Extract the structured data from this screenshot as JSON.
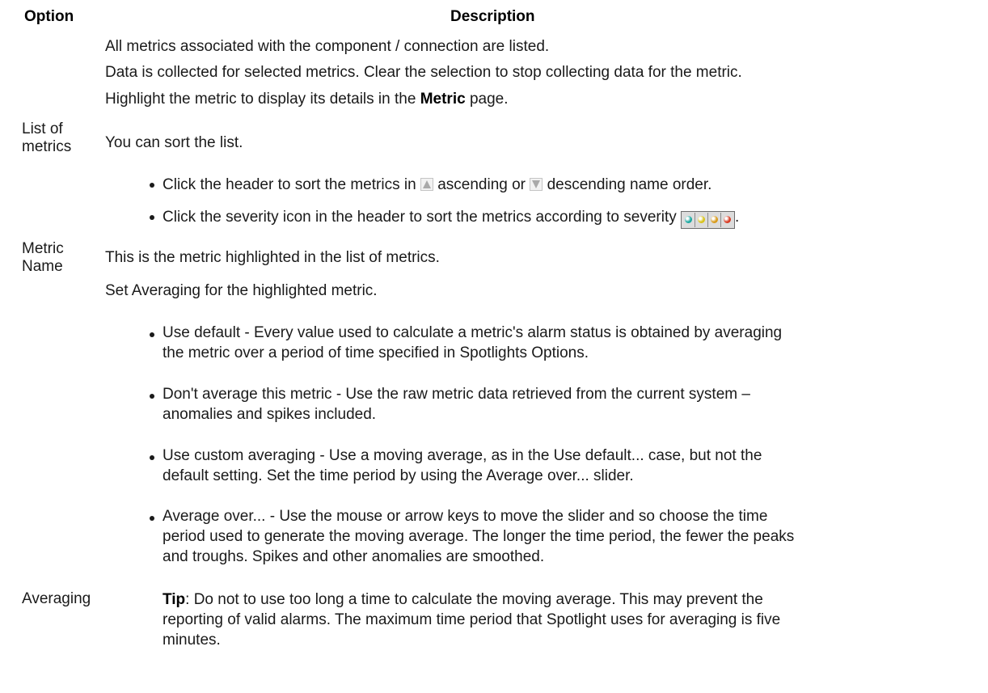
{
  "header": {
    "option": "Option",
    "description": "Description"
  },
  "rows": {
    "list_of_metrics": {
      "label_line1": "List of",
      "label_line2": "metrics",
      "p1": "All metrics associated with the component / connection are listed.",
      "p2": "Data is collected for selected metrics. Clear the selection to stop collecting data for the metric.",
      "p3_before": "Highlight the metric to display its details in the",
      "p3_bold": "Metric",
      "p3_after": "page.",
      "p4": "You can sort the list.",
      "bullet1_before": "Click the header to sort the metrics in",
      "bullet1_mid": "ascending or",
      "bullet1_after": "descending name order.",
      "bullet2": "Click the severity icon in the header to sort the metrics according to severity",
      "bullet2_end": ".",
      "icons": {
        "ascending": "sort-ascending-icon",
        "descending": "sort-descending-icon",
        "severity": [
          "severity-normal-icon",
          "severity-low-icon",
          "severity-medium-icon",
          "severity-high-icon"
        ]
      },
      "severity_colors": [
        "#1aa8a0",
        "#d8c21a",
        "#d89a1a",
        "#d83a22"
      ]
    },
    "metric_name": {
      "label_line1": "Metric",
      "label_line2": "Name",
      "text": "This is the metric highlighted in the list of metrics."
    },
    "averaging": {
      "label": "Averaging",
      "intro": "Set Averaging for the highlighted metric.",
      "b1_line1": "Use default - Every value used to calculate a metric's alarm status is obtained by averaging",
      "b1_line2": "the metric over a period of time specified in Spotlights Options.",
      "b2_line1": "Don't average this metric - Use the raw metric data retrieved from the current system –",
      "b2_line2": "anomalies and spikes included.",
      "b3_line1": "Use custom averaging - Use a moving average, as in the Use default... case, but not the",
      "b3_line2": "default setting. Set the time period by using the Average over... slider.",
      "b4_line1": "Average over... - Use the mouse or arrow keys to move the slider and so choose the time",
      "b4_line2": "period used to generate the moving average. The longer the time period, the fewer the peaks",
      "b4_line3": "and troughs. Spikes and other anomalies are smoothed.",
      "tip_label": "Tip",
      "tip_line1": ": Do not to use too long a time to calculate the moving average. This may prevent the",
      "tip_line2": "reporting of valid alarms. The maximum time period that Spotlight uses for averaging is five",
      "tip_line3": "minutes."
    }
  }
}
